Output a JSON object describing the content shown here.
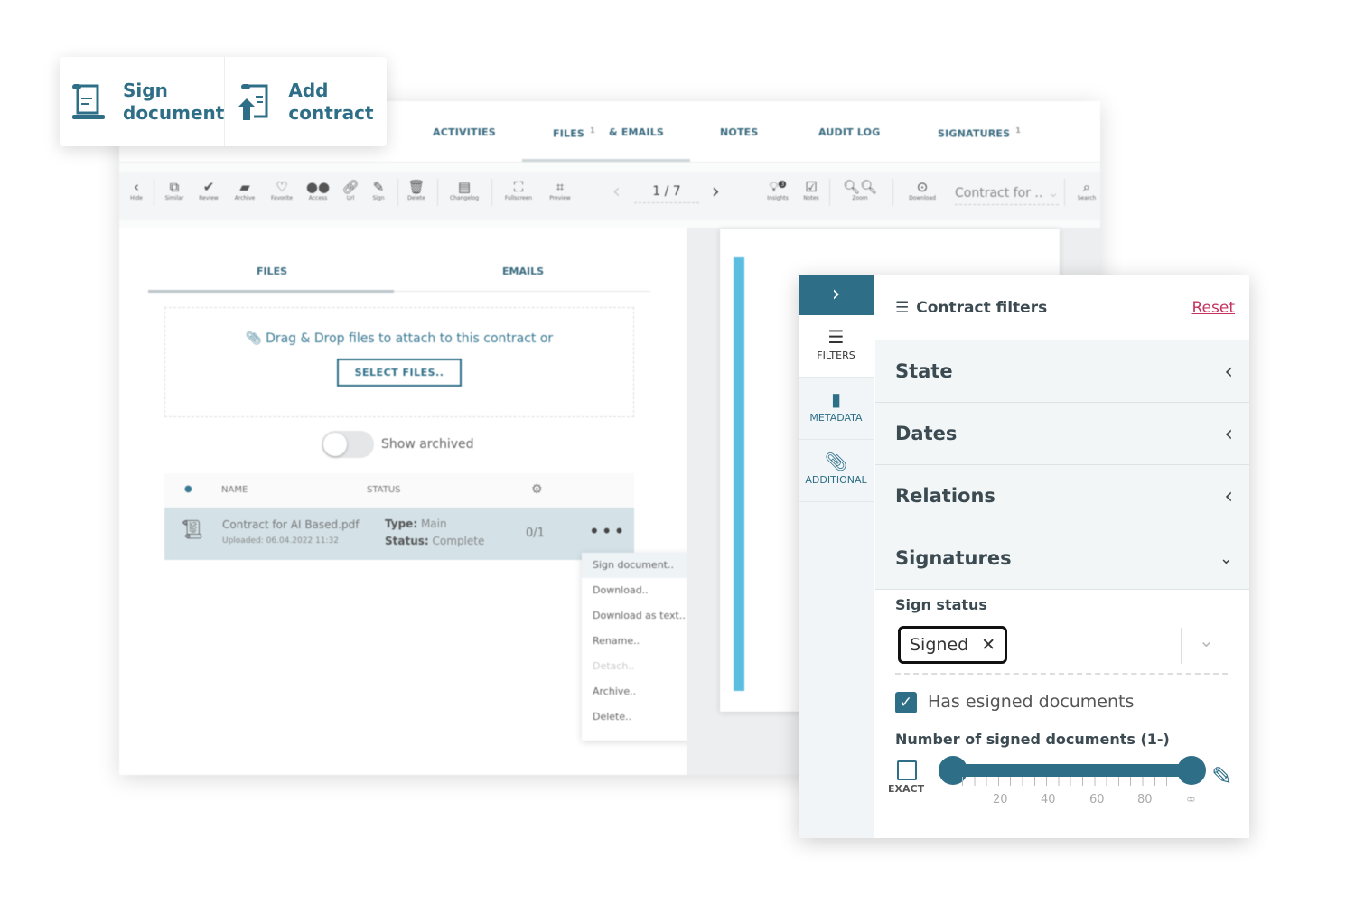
{
  "quick_actions": [
    {
      "label_1": "Sign",
      "label_2": "document",
      "icon": "sign-document-icon"
    },
    {
      "label_1": "Add",
      "label_2": "contract",
      "icon": "add-contract-icon"
    }
  ],
  "tabs": [
    {
      "label": "ACTIVITIES"
    },
    {
      "label": "FILES",
      "badge": "1"
    },
    {
      "label": "& EMAILS"
    },
    {
      "label": "NOTES"
    },
    {
      "label": "AUDIT LOG"
    },
    {
      "label": "SIGNATURES",
      "badge": "1"
    }
  ],
  "toolbar": {
    "items": [
      "Hide",
      "Similar",
      "Review",
      "Archive",
      "Favorite",
      "Access",
      "Url",
      "Sign",
      "Delete",
      "Changelog",
      "Fullscreen",
      "Preview"
    ],
    "pager": "1 / 7",
    "insights": "Insights",
    "insights_badge": "3",
    "notes": "Notes",
    "zoom": "Zoom",
    "download": "Download",
    "doc_select": "Contract for ..",
    "search": "Search"
  },
  "files": {
    "tabs": [
      "FILES",
      "EMAILS"
    ],
    "drop_text": "Drag & Drop files to attach to this contract or",
    "select_button": "SELECT FILES..",
    "show_archived": "Show archived",
    "show_archived_on": false,
    "columns": [
      "NAME",
      "STATUS"
    ],
    "rows": [
      {
        "name": "Contract for AI Based.pdf",
        "uploaded": "Uploaded: 06.04.2022 11:32",
        "type_label": "Type:",
        "type": "Main",
        "status_label": "Status:",
        "status": "Complete",
        "signatures": "0/1"
      }
    ],
    "menu": [
      "Sign document..",
      "Download..",
      "Download as text..",
      "Rename..",
      "Detach..",
      "Archive..",
      "Delete.."
    ]
  },
  "filters": {
    "sidebar": [
      "FILTERS",
      "METADATA",
      "ADDITIONAL"
    ],
    "title": "Contract filters",
    "reset": "Reset",
    "sections": [
      "State",
      "Dates",
      "Relations",
      "Signatures"
    ],
    "sign_status_label": "Sign status",
    "sign_status_chip": "Signed",
    "has_esigned": "Has esigned documents",
    "has_esigned_checked": true,
    "number_label": "Number of signed documents (1-)",
    "exact": "EXACT",
    "exact_checked": false,
    "slider_ticks": [
      "20",
      "40",
      "60",
      "80",
      "∞"
    ],
    "slider_range": [
      1,
      "∞"
    ]
  },
  "colors": {
    "accent": "#2e6f87",
    "reset": "#c4345e",
    "row_highlight": "#d4e2e8"
  }
}
